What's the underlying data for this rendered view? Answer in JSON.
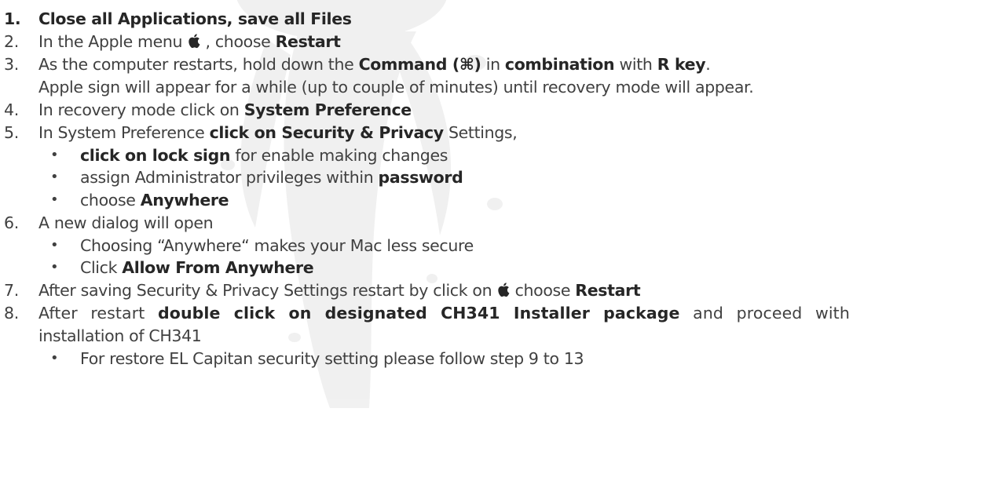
{
  "steps": [
    {
      "num": "1.",
      "parts": [
        {
          "t": "Close all Applications, save all Files",
          "b": true
        }
      ]
    },
    {
      "num": "2.",
      "parts": [
        {
          "t": "In the Apple menu "
        },
        {
          "icon": "apple"
        },
        {
          "t": " , choose "
        },
        {
          "t": "Restart",
          "b": true
        }
      ]
    },
    {
      "num": "3.",
      "parts": [
        {
          "t": "As the computer restarts, hold down the "
        },
        {
          "t": "Command (⌘)",
          "b": true
        },
        {
          "t": " in "
        },
        {
          "t": "combination",
          "b": true
        },
        {
          "t": " with "
        },
        {
          "t": "R key",
          "b": true
        },
        {
          "t": "."
        }
      ]
    },
    {
      "num": "",
      "parts": [
        {
          "t": "Apple sign will appear for a while (up to couple of minutes) until recovery mode will appear."
        }
      ]
    },
    {
      "num": "4.",
      "parts": [
        {
          "t": "In recovery mode click on "
        },
        {
          "t": "System Preference",
          "b": true
        }
      ]
    },
    {
      "num": "5.",
      "parts": [
        {
          "t": "In System Preference "
        },
        {
          "t": "click on Security & Privacy",
          "b": true
        },
        {
          "t": " Settings,"
        }
      ]
    },
    {
      "bullet": "•",
      "parts": [
        {
          "t": " "
        },
        {
          "t": "click on lock sign",
          "b": true
        },
        {
          "t": " for enable making changes"
        }
      ]
    },
    {
      "bullet": "•",
      "parts": [
        {
          "t": "assign Administrator privileges within "
        },
        {
          "t": "password",
          "b": true
        }
      ]
    },
    {
      "bullet": "•",
      "parts": [
        {
          "t": "choose "
        },
        {
          "t": "Anywhere",
          "b": true
        }
      ]
    },
    {
      "num": "6.",
      "parts": [
        {
          "t": " A new dialog will open"
        }
      ]
    },
    {
      "bullet": "•",
      "parts": [
        {
          "t": "Choosing “Anywhere“ makes your Mac less secure"
        }
      ]
    },
    {
      "bullet": "•",
      "parts": [
        {
          "t": "Click "
        },
        {
          "t": "Allow From Anywhere",
          "b": true
        }
      ]
    },
    {
      "num": "7.",
      "parts": [
        {
          "t": "After saving Security & Privacy Settings restart  by click on "
        },
        {
          "icon": "apple"
        },
        {
          "t": "  choose "
        },
        {
          "t": "Restart",
          "b": true
        }
      ]
    },
    {
      "num": "8.",
      "justify": true,
      "parts": [
        {
          "t": "After restart "
        },
        {
          "t": "double click on designated CH341 Installer package",
          "b": true
        },
        {
          "t": " and proceed with"
        }
      ]
    },
    {
      "num": "",
      "parts": [
        {
          "t": "installation of CH341"
        }
      ]
    },
    {
      "bullet": "•",
      "parts": [
        {
          "t": "For restore EL Capitan security setting please follow step 9 to 13"
        }
      ]
    }
  ],
  "colors": {
    "text": "#404040",
    "bold": "#262626",
    "watermark": "#e6e6e6"
  }
}
